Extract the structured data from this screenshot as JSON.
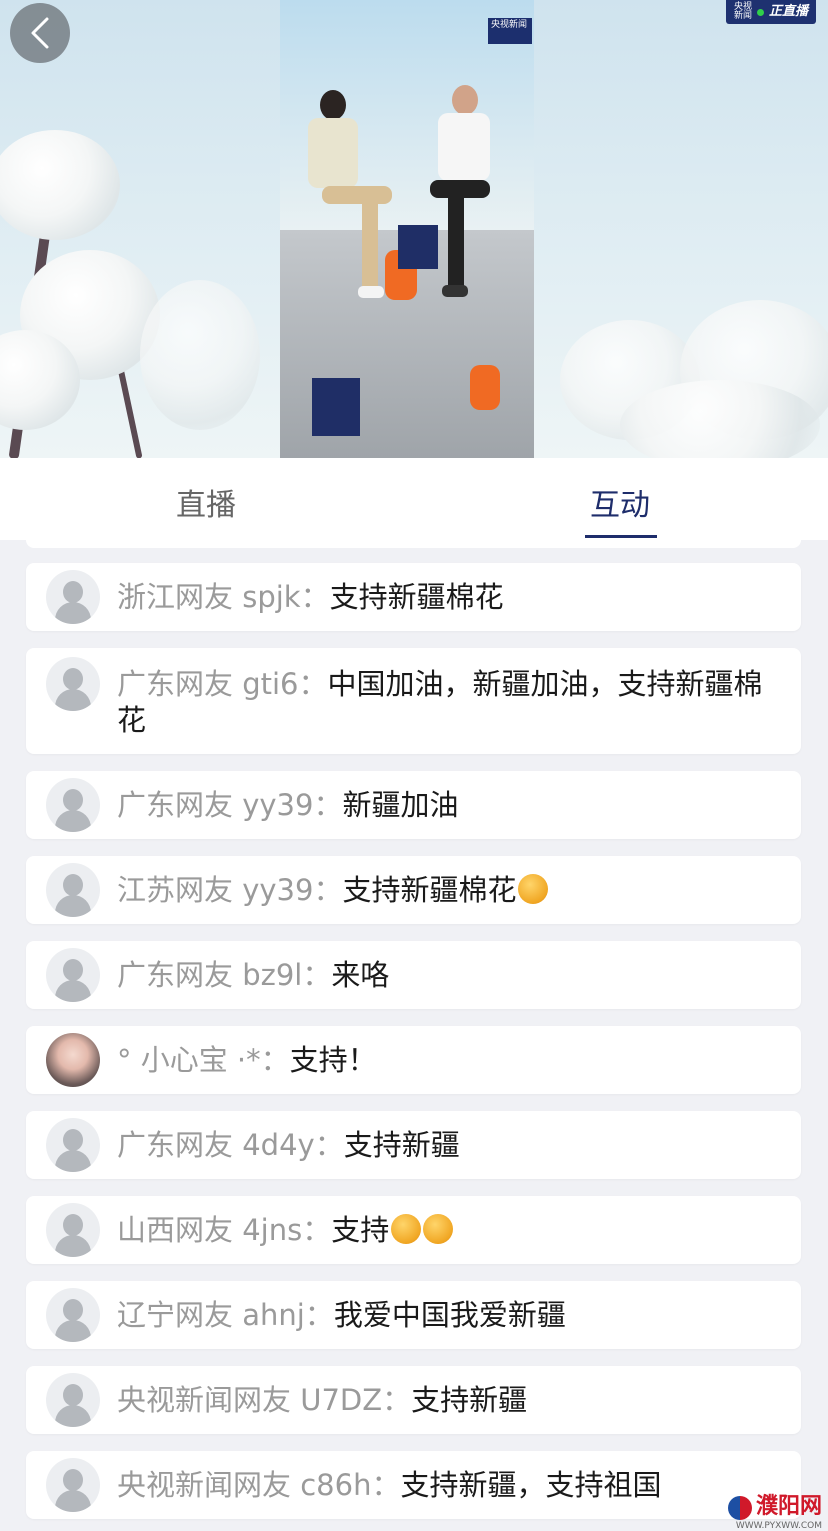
{
  "header": {
    "live_badge": "正直播",
    "cctv_badge": "央视新闻"
  },
  "tabs": [
    {
      "label": "直播"
    },
    {
      "label": "互动"
    }
  ],
  "active_tab": "互动",
  "comments": [
    {
      "nick": "浙江网友 spjk：",
      "text": "支持新疆棉花"
    },
    {
      "nick": "广东网友 gti6：",
      "text": "中国加油，新疆加油，支持新疆棉花"
    },
    {
      "nick": "广东网友 yy39：",
      "text": "新疆加油"
    },
    {
      "nick": "江苏网友 yy39：",
      "text": "支持新疆棉花",
      "emoji": "thumbs-up"
    },
    {
      "nick": "广东网友 bz9l：",
      "text": "来咯"
    },
    {
      "nick": "° 小心宝 ·*：",
      "text": "支持！",
      "avatar": "photo"
    },
    {
      "nick": "广东网友 4d4y：",
      "text": "支持新疆"
    },
    {
      "nick": "山西网友 4jns：",
      "text": "支持",
      "emoji": "flexed-biceps x2"
    },
    {
      "nick": "辽宁网友 ahnj：",
      "text": "我爱中国我爱新疆"
    },
    {
      "nick": "央视新闻网友 U7DZ：",
      "text": "支持新疆"
    },
    {
      "nick": "央视新闻网友 c86h：",
      "text": "支持新疆，支持祖国"
    }
  ],
  "watermark": {
    "name": "濮阳网",
    "url": "WWW.PYXWW.COM"
  }
}
